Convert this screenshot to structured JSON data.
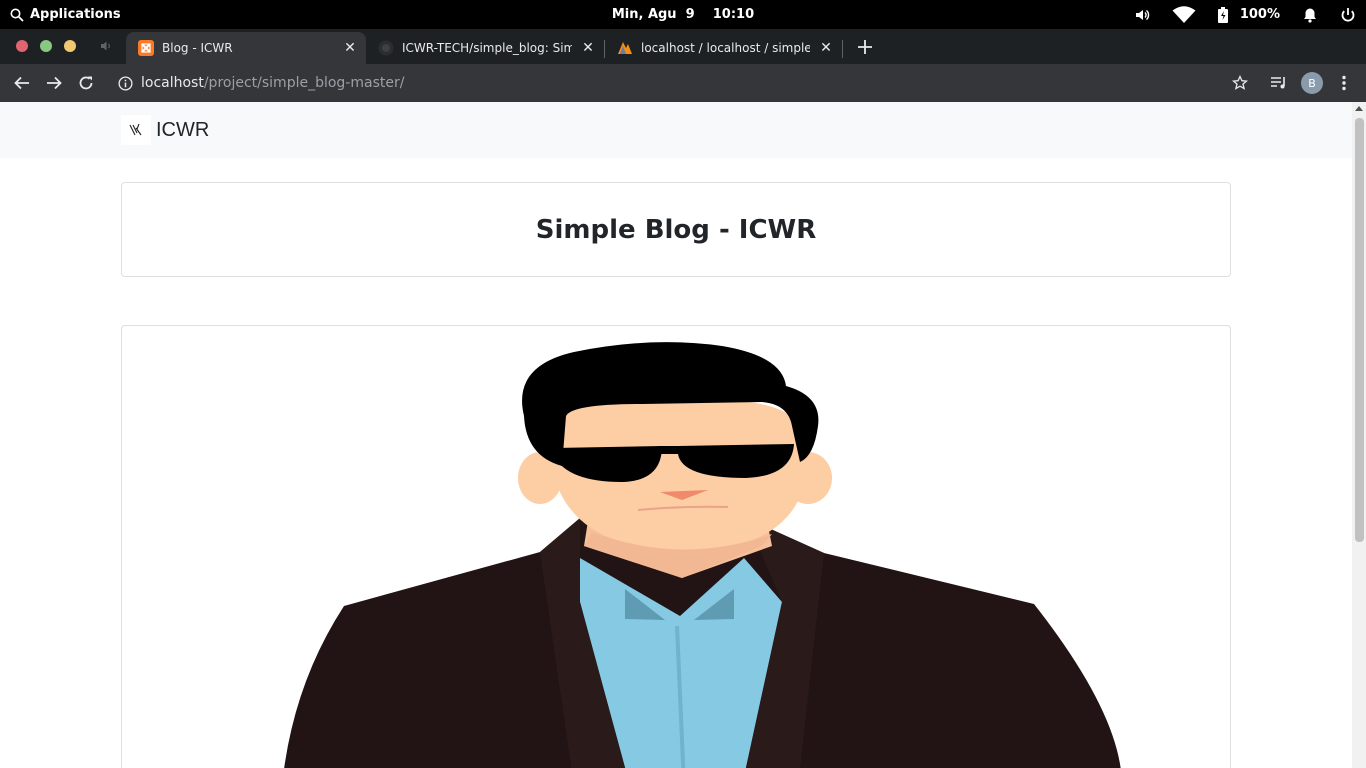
{
  "top_panel": {
    "applications_label": "Applications",
    "clock": "Min, Agu  9    10:10",
    "battery_label": "100%"
  },
  "tabs": [
    {
      "title": "Blog - ICWR",
      "active": true
    },
    {
      "title": "ICWR-TECH/simple_blog: Simple",
      "active": false
    },
    {
      "title": "localhost / localhost / simple_blo",
      "active": false
    }
  ],
  "toolbar": {
    "url_host": "localhost",
    "url_path": "/project/simple_blog-master/",
    "profile_initial": "B"
  },
  "page": {
    "brand": "ICWR",
    "blog_title": "Simple Blog - ICWR"
  },
  "colors": {
    "accent_xampp": "#fb7a24",
    "skin": "#fdcda4",
    "jacket": "#221414",
    "shirt": "#85c9e3"
  }
}
